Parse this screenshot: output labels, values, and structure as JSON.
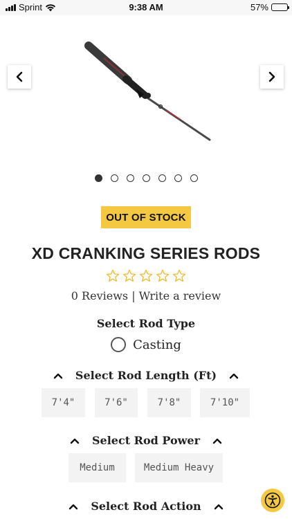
{
  "status_bar": {
    "carrier": "Sprint",
    "time": "9:38 AM",
    "battery_text": "57%",
    "battery_level": 0.57,
    "icons": [
      "signal-icon",
      "wifi-icon",
      "battery-icon"
    ]
  },
  "gallery": {
    "image_count": 7,
    "active_index": 0,
    "prev_icon": "chevron-left-icon",
    "next_icon": "chevron-right-icon"
  },
  "product": {
    "stock_badge": "OUT OF STOCK",
    "title": "XD CRANKING SERIES RODS",
    "rating_stars": 0,
    "reviews_text": "0 Reviews",
    "separator": "|",
    "write_review": "Write a review"
  },
  "rod_type": {
    "label": "Select Rod Type",
    "options": [
      "Casting"
    ]
  },
  "rod_length": {
    "label": "Select Rod Length (Ft)",
    "options": [
      "7'4\"",
      "7'6\"",
      "7'8\"",
      "7'10\""
    ]
  },
  "rod_power": {
    "label": "Select Rod Power",
    "options": [
      "Medium",
      "Medium Heavy"
    ]
  },
  "rod_action": {
    "label": "Select Rod Action"
  },
  "colors": {
    "accent": "#f5c842",
    "option_bg": "#f3f3f3"
  },
  "accessibility_icon": "accessibility-icon"
}
